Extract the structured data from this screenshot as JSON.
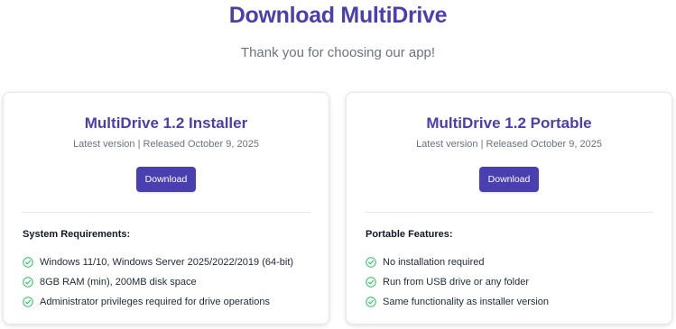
{
  "page": {
    "title": "Download MultiDrive",
    "subtitle": "Thank you for choosing our app!"
  },
  "colors": {
    "accent": "#4a3fb0",
    "check": "#22c55e",
    "muted_text": "#6b7280"
  },
  "installer": {
    "title": "MultiDrive 1.2 Installer",
    "meta": "Latest version | Released October 9, 2025",
    "button_label": "Download",
    "section_heading": "System Requirements:",
    "items": [
      "Windows 11/10, Windows Server 2025/2022/2019 (64-bit)",
      "8GB RAM (min), 200MB disk space",
      "Administrator privileges required for drive operations"
    ]
  },
  "portable": {
    "title": "MultiDrive 1.2 Portable",
    "meta": "Latest version | Released October 9, 2025",
    "button_label": "Download",
    "section_heading": "Portable Features:",
    "items": [
      "No installation required",
      "Run from USB drive or any folder",
      "Same functionality as installer version"
    ]
  },
  "icons": {
    "list_bullet": "check-circle-icon"
  }
}
